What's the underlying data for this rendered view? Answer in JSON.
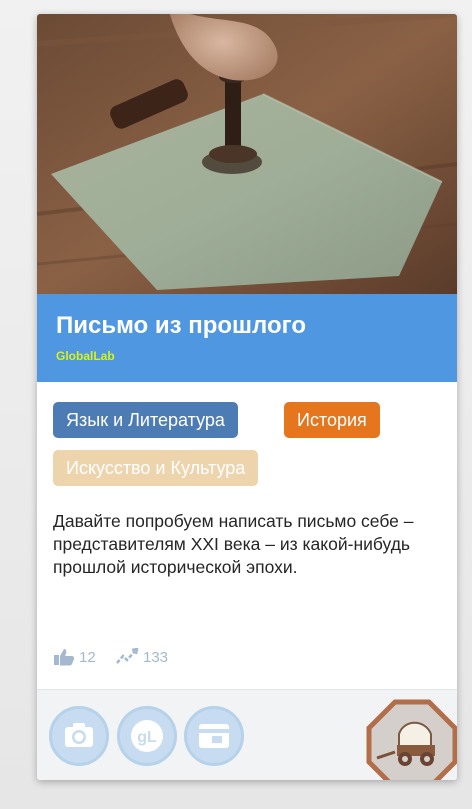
{
  "card": {
    "title": "Письмо из прошлого",
    "author": "GlobalLab",
    "tags": [
      {
        "label": "Язык и Литература",
        "color": "#4d7cb4"
      },
      {
        "label": "История",
        "color": "#e5761d"
      },
      {
        "label": "Искусство и Культура",
        "color": "#eed4ac"
      }
    ],
    "description": "Давайте попробуем написать письмо себе – представителям XXI века – из какой-нибудь прошлой исторической эпохи.",
    "stats": {
      "likes": "12",
      "views": "133"
    },
    "footer_icons": [
      "camera-icon",
      "globallab-icon",
      "card-icon"
    ],
    "badge_icon": "wagon-icon"
  },
  "colors": {
    "title_band": "#4f97e0",
    "author": "#d9f21a",
    "stat": "#a4b9d0",
    "footer_icon": "#c7dcf0",
    "badge_border": "#b26d49"
  }
}
